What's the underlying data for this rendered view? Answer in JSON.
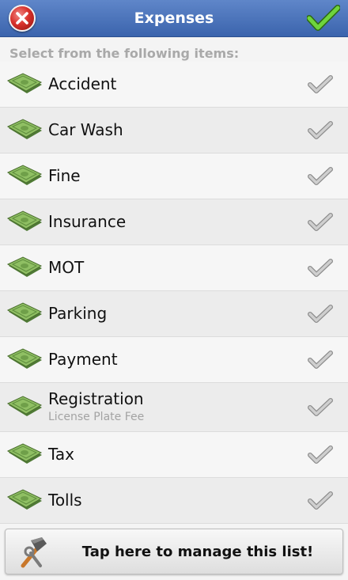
{
  "header": {
    "title": "Expenses",
    "close_icon": "close-icon",
    "done_icon": "checkmark-icon"
  },
  "prompt": "Select from the following items:",
  "items": [
    {
      "label": "Accident",
      "sublabel": ""
    },
    {
      "label": "Car Wash",
      "sublabel": ""
    },
    {
      "label": "Fine",
      "sublabel": ""
    },
    {
      "label": "Insurance",
      "sublabel": ""
    },
    {
      "label": "MOT",
      "sublabel": ""
    },
    {
      "label": "Parking",
      "sublabel": ""
    },
    {
      "label": "Payment",
      "sublabel": ""
    },
    {
      "label": "Registration",
      "sublabel": "License Plate Fee"
    },
    {
      "label": "Tax",
      "sublabel": ""
    },
    {
      "label": "Tolls",
      "sublabel": ""
    }
  ],
  "item_icon": "banknote-icon",
  "item_check_icon": "checkmark-icon",
  "footer": {
    "label": "Tap here to manage this list!",
    "icon": "tools-icon"
  },
  "colors": {
    "titlebar": "#3b64ad",
    "close": "#d9312b",
    "check_active": "#4caf2a",
    "check_inactive": "#b5b5b5"
  }
}
